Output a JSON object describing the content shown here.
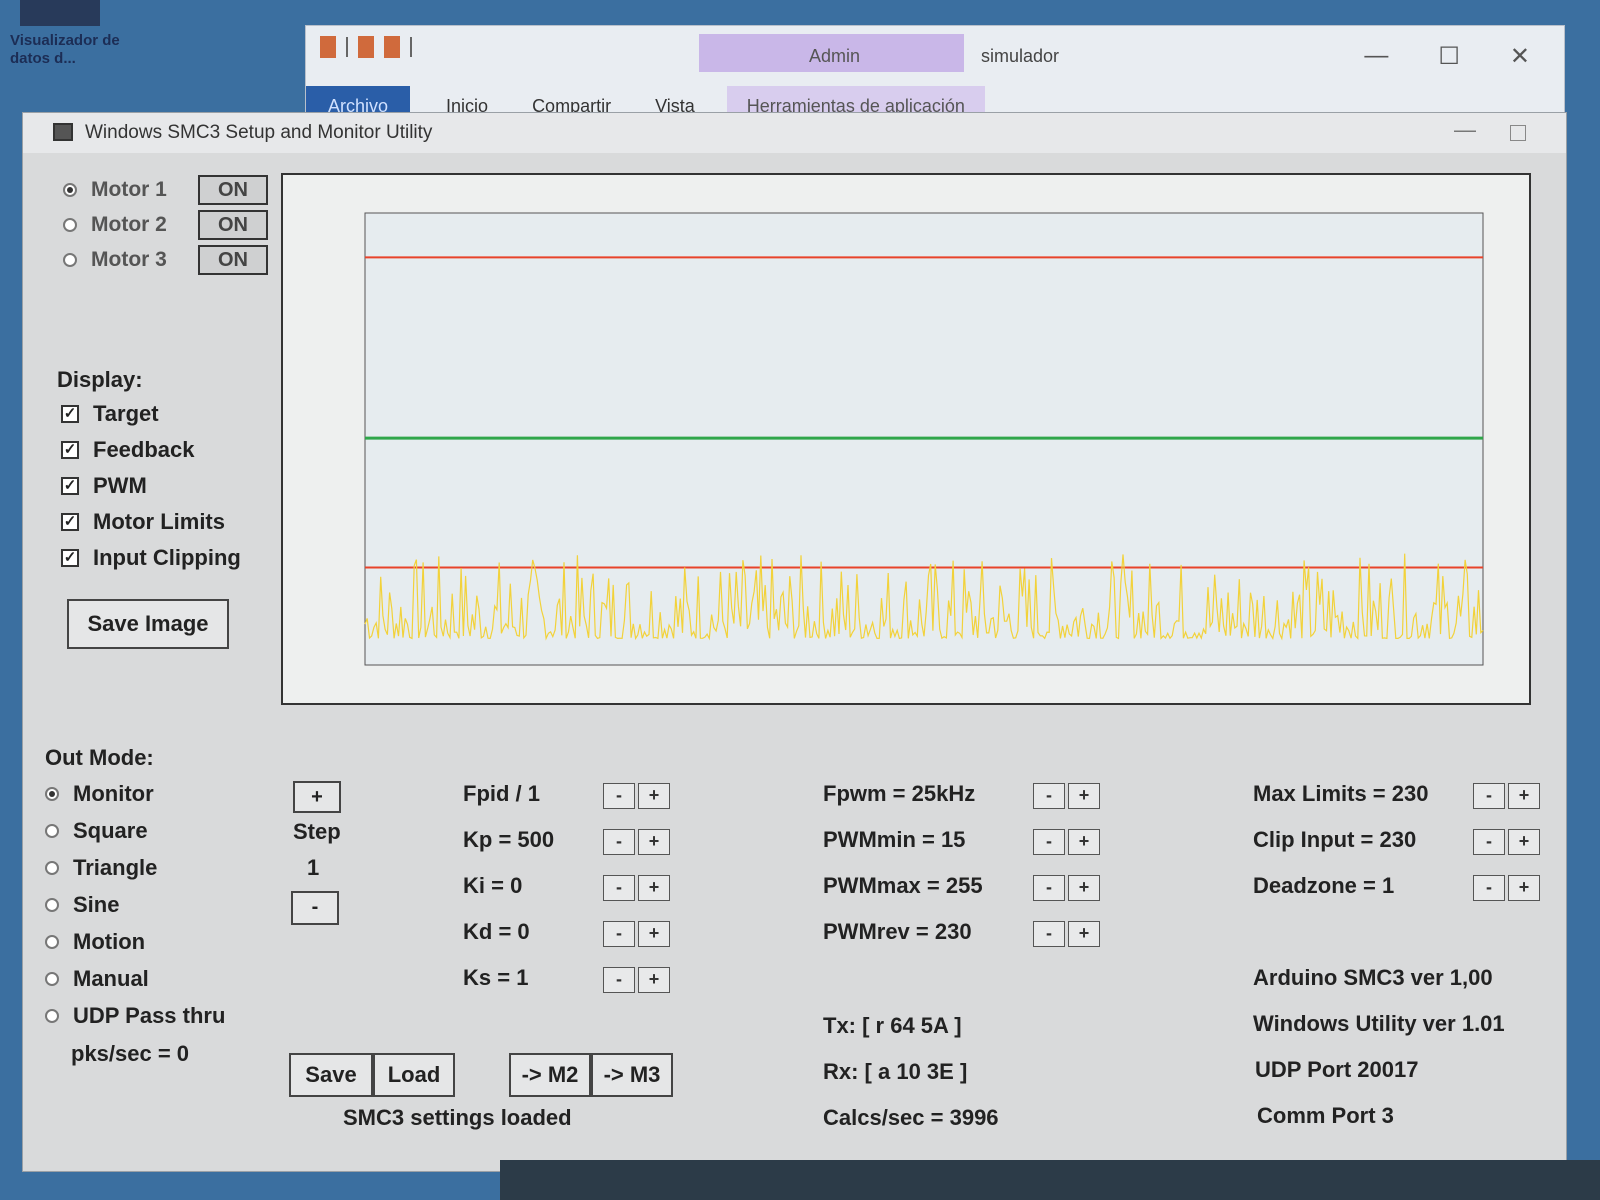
{
  "desktop": {
    "shortcut_label": "Visualizador de datos d..."
  },
  "explorer": {
    "title": "simulador",
    "tools_tab": "Admin",
    "ribbon_tabs": [
      "Archivo",
      "Inicio",
      "Compartir",
      "Vista"
    ],
    "app_tools_tab": "Herramientas de aplicación",
    "min": "—",
    "max": "☐",
    "close": "✕"
  },
  "window": {
    "title": "Windows SMC3 Setup and Monitor Utility",
    "min": "—"
  },
  "motors": [
    {
      "label": "Motor 1",
      "selected": true,
      "state": "ON"
    },
    {
      "label": "Motor 2",
      "selected": false,
      "state": "ON"
    },
    {
      "label": "Motor 3",
      "selected": false,
      "state": "ON"
    }
  ],
  "display": {
    "title": "Display:",
    "options": [
      "Target",
      "Feedback",
      "PWM",
      "Motor Limits",
      "Input Clipping"
    ],
    "save_image": "Save Image"
  },
  "chart_data": {
    "type": "line",
    "title": "",
    "grid": false,
    "xlim": [
      0,
      1000
    ],
    "ylim": [
      0,
      255
    ],
    "series": [
      {
        "color": "#e8432a",
        "values_const": 230
      },
      {
        "color": "#2fa64a",
        "values_const": 128
      },
      {
        "color": "#e8432a",
        "values_const": 55
      },
      {
        "color": "#f2d23a",
        "noise_base": 15,
        "noise_peak": 55
      }
    ]
  },
  "out_mode": {
    "title": "Out Mode:",
    "options": [
      "Monitor",
      "Square",
      "Triangle",
      "Sine",
      "Motion",
      "Manual",
      "UDP Pass thru"
    ],
    "selected": "Monitor",
    "pks": "pks/sec = 0"
  },
  "step": {
    "plus": "+",
    "label": "Step",
    "value": "1",
    "minus": "-"
  },
  "pid": [
    "Fpid / 1",
    "Kp = 500",
    "Ki = 0",
    "Kd = 0",
    "Ks = 1"
  ],
  "pwm": [
    "Fpwm = 25kHz",
    "PWMmin = 15",
    "PWMmax = 255",
    "PWMrev = 230"
  ],
  "limits": [
    "Max Limits = 230",
    "Clip Input = 230",
    "Deadzone = 1"
  ],
  "buttons": {
    "save": "Save",
    "load": "Load",
    "to_m2": "-> M2",
    "to_m3": "-> M3"
  },
  "status": "SMC3 settings loaded",
  "comm": {
    "tx": "Tx: [ r 64 5A ]",
    "rx": "Rx: [ a 10 3E ]",
    "calcs": "Calcs/sec = 3996"
  },
  "info": [
    "Arduino SMC3 ver 1,00",
    "Windows Utility ver 1.01",
    "UDP Port 20017",
    "Comm Port 3"
  ],
  "pm_labels": {
    "minus": "-",
    "plus": "+"
  }
}
